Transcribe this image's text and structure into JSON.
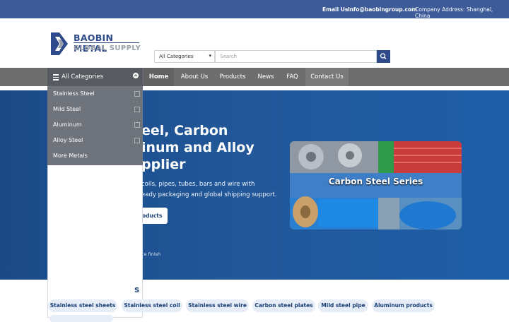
{
  "topbar": {
    "email_label": "Email Us:",
    "email_value": "info@baobingroup.com",
    "address": "Company Address: Shanghai, China"
  },
  "header": {
    "logo_line1": "BAOBIN METAL",
    "logo_line2": "GLOBAL SUPPLY",
    "category_select": "All Categories",
    "search_placeholder": "Search"
  },
  "nav": {
    "categories_label": "All Categories",
    "links": [
      "Home",
      "About Us",
      "Products",
      "News",
      "FAQ",
      "Contact Us"
    ]
  },
  "dropdown": {
    "items": [
      "Stainless Steel",
      "Mild Steel",
      "Aluminum",
      "Alloy Steel",
      "More Metals"
    ]
  },
  "hero": {
    "title_line1": "eel, Carbon",
    "title_line2": "inum and Alloy",
    "title_line3": "pplier",
    "subtitle_line1": "coils, pipes, tubes, bars and wire with",
    "subtitle_line2": "eady packaging and global shipping support.",
    "button_label": "oducts",
    "note": "ce finish",
    "image_caption": "Carbon Steel Series"
  },
  "tags": {
    "title": "S",
    "items": [
      "Stainless steel sheets",
      "Stainless steel coil",
      "Stainless steel wire",
      "Carbon steel plates",
      "Mild steel pipe",
      "Aluminum products"
    ]
  },
  "colors": {
    "brand_blue": "#2e4a8a",
    "topbar": "#3d5a99",
    "nav_bar": "#6e6e6e",
    "hero_bg": "#22589a"
  }
}
